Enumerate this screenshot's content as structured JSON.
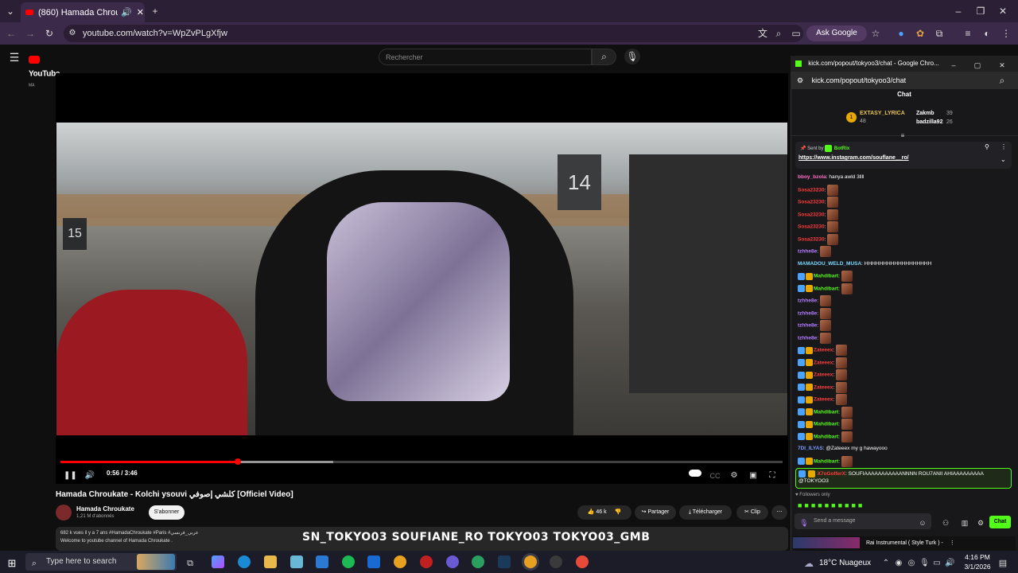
{
  "browser": {
    "tab_title": "(860) Hamada Chroukate - ...",
    "url": "youtube.com/watch?v=WpZvPLgXfjw",
    "ask_google": "Ask Google"
  },
  "youtube": {
    "logo_text": "YouTube",
    "logo_region": "MA",
    "search_placeholder": "Rechercher",
    "progress_fraction": 0.246,
    "time": "0:56 / 3:46",
    "video_title": "Hamada Chroukate - Kolchi ysouvi كلشي إصوفي [Officiel Video]",
    "channel_name": "Hamada Chroukate",
    "subscribers": "1,21 M d'abonnés",
    "subscribe": "S'abonner",
    "likes": "46 k",
    "share": "Partager",
    "download": "Télécharger",
    "clip": "Clip",
    "desc_line1": "682 k vues  il y a 7 ans  #HamadaChroukate #Paris #عربي_فرنسي",
    "desc_line2": "Welcome to youtube channel of Hamada Chroukate .",
    "overlay_socials": "SN_TOKYO03  SOUFIANE_RO  TOKYO03  TOKYO03_GMB"
  },
  "kick": {
    "window_title": "kick.com/popout/tokyoo3/chat - Google Chro...",
    "url": "kick.com/popout/tokyoo3/chat",
    "chat_label": "Chat",
    "gifter1_name": "EXTASY_LYRICA",
    "gifter1_count": "48",
    "gifter2_name": "Zakmb",
    "gifter2_count": "39",
    "gifter3_name": "badzilla92",
    "gifter3_count": "26",
    "pinned_sent_by": "Sent by",
    "pinned_bot": "BotRix",
    "pinned_link": "https://www.instagram.com/souflane__ro/",
    "messages": [
      {
        "user": "bboy_bzola",
        "text": "hanya awld 3llll",
        "color": "#ff6ec7"
      },
      {
        "user": "Sosa23230",
        "text": "",
        "color": "#ff3b3b"
      },
      {
        "user": "Sosa23230",
        "text": "",
        "color": "#ff3b3b"
      },
      {
        "user": "Sosa23230",
        "text": "",
        "color": "#ff3b3b"
      },
      {
        "user": "Sosa23230",
        "text": "",
        "color": "#ff3b3b"
      },
      {
        "user": "Sosa23230",
        "text": "",
        "color": "#ff3b3b"
      },
      {
        "user": "tzhhe8e",
        "text": "",
        "color": "#b57bff"
      },
      {
        "user": "MAMADOU_WELD_MUSA",
        "text": "HHHHHHHHHHHHHHHHHH",
        "color": "#7bd8ff"
      },
      {
        "user": "Mahdibart",
        "text": "",
        "color": "#53fc18"
      },
      {
        "user": "Mahdibart",
        "text": "",
        "color": "#53fc18"
      },
      {
        "user": "tzhhe8e",
        "text": "",
        "color": "#b57bff"
      },
      {
        "user": "tzhhe8e",
        "text": "",
        "color": "#b57bff"
      },
      {
        "user": "tzhhe8e",
        "text": "",
        "color": "#b57bff"
      },
      {
        "user": "tzhhe8e",
        "text": "",
        "color": "#b57bff"
      },
      {
        "user": "Zateeex",
        "text": "",
        "color": "#ff3b3b"
      },
      {
        "user": "Zateeex",
        "text": "",
        "color": "#ff3b3b"
      },
      {
        "user": "Zateeex",
        "text": "",
        "color": "#ff3b3b"
      },
      {
        "user": "Zateeex",
        "text": "",
        "color": "#ff3b3b"
      },
      {
        "user": "Zateeex",
        "text": "",
        "color": "#ff3b3b"
      },
      {
        "user": "Mahdibart",
        "text": "",
        "color": "#53fc18"
      },
      {
        "user": "Mahdibart",
        "text": "",
        "color": "#53fc18"
      },
      {
        "user": "Mahdibart",
        "text": "",
        "color": "#53fc18"
      },
      {
        "user": "7DI_ILYAS",
        "text": "@Zateeex my g hawayooo",
        "color": "#7b9bff"
      },
      {
        "user": "Mahdibart",
        "text": "",
        "color": "#53fc18"
      }
    ],
    "highlight_user": "X7oGolferX",
    "highlight_text": ": SOUFIAAAAAAAAAAANNNN ROU7ANII AHIAAAAAAAAA @TOKYOO3",
    "followers_only": "Followers only",
    "send_placeholder": "Send a message",
    "chat_button": "Chat",
    "yt_bottom": "Rai Instrumental ( Style Turk ) -"
  },
  "taskbar": {
    "search": "Type here to search",
    "weather": "18°C  Nuageux",
    "time": "4:16 PM",
    "date": "3/1/2026"
  },
  "colors": {
    "accent_red": "#ff0000",
    "kick_green": "#53fc18"
  }
}
